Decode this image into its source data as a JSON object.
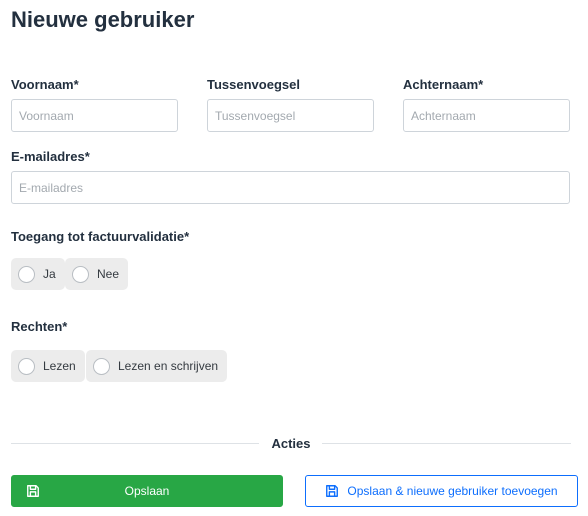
{
  "page": {
    "title": "Nieuwe gebruiker"
  },
  "fields": {
    "first_name": {
      "label": "Voornaam*",
      "placeholder": "Voornaam",
      "value": ""
    },
    "infix": {
      "label": "Tussenvoegsel",
      "placeholder": "Tussenvoegsel",
      "value": ""
    },
    "last_name": {
      "label": "Achternaam*",
      "placeholder": "Achternaam",
      "value": ""
    },
    "email": {
      "label": "E-mailadres*",
      "placeholder": "E-mailadres",
      "value": ""
    }
  },
  "invoice_access": {
    "label": "Toegang tot factuurvalidatie*",
    "options": [
      "Ja",
      "Nee"
    ],
    "selected": null
  },
  "rights": {
    "label": "Rechten*",
    "options": [
      "Lezen",
      "Lezen en schrijven"
    ],
    "selected": null
  },
  "actions": {
    "title": "Acties",
    "save_label": "Opslaan",
    "save_new_label": "Opslaan & nieuwe gebruiker toevoegen",
    "save_color": "#28a745",
    "save_new_color": "#0d6efd",
    "icon": "floppy-disk-icon"
  }
}
